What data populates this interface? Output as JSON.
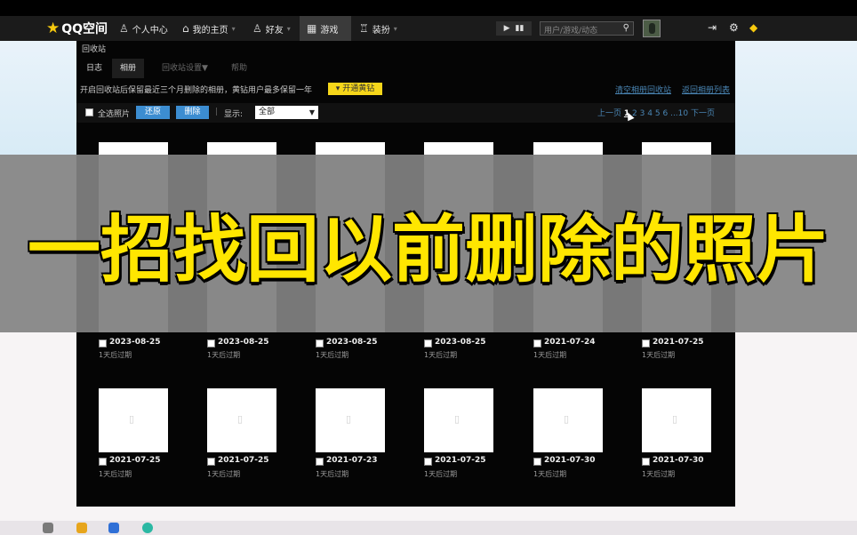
{
  "topbar": {
    "logo_text": "QQ空间",
    "nav": [
      {
        "label": "个人中心",
        "icon": "user-icon"
      },
      {
        "label": "我的主页",
        "icon": "home-icon"
      },
      {
        "label": "好友",
        "icon": "friends-icon"
      },
      {
        "label": "游戏",
        "icon": "grid-icon",
        "active": true
      },
      {
        "label": "装扮",
        "icon": "shirt-icon"
      }
    ],
    "search_placeholder": "用户/游戏/动态"
  },
  "panel": {
    "title": "回收站",
    "tabs": [
      "日志",
      "相册",
      "回收站设置▼",
      "帮助"
    ],
    "notice": "开启回收站后保留最近三个月删除的相册，黄钻用户最多保留一年",
    "vip_button": "开通黄钻",
    "links": [
      "清空相册回收站",
      "返回相册列表"
    ],
    "toolbar": {
      "select_all": "全选照片",
      "restore": "还原",
      "delete": "删除",
      "display_label": "显示:",
      "display_value": "全部"
    },
    "pager": {
      "prev": "上一页",
      "pages": [
        "1",
        "2",
        "3",
        "4",
        "5",
        "6",
        "...10"
      ],
      "current": "1",
      "next": "下一页"
    }
  },
  "photos": [
    {
      "date": "2023-08-25",
      "expire": "1天后过期"
    },
    {
      "date": "2023-08-25",
      "expire": "1天后过期"
    },
    {
      "date": "2023-08-25",
      "expire": "1天后过期"
    },
    {
      "date": "2023-08-25",
      "expire": "1天后过期"
    },
    {
      "date": "2021-07-24",
      "expire": "1天后过期"
    },
    {
      "date": "2021-07-25",
      "expire": "1天后过期"
    },
    {
      "date": "2021-07-25",
      "expire": "1天后过期"
    },
    {
      "date": "2021-07-25",
      "expire": "1天后过期"
    },
    {
      "date": "2021-07-23",
      "expire": "1天后过期"
    },
    {
      "date": "2021-07-25",
      "expire": "1天后过期"
    },
    {
      "date": "2021-07-30",
      "expire": "1天后过期"
    },
    {
      "date": "2021-07-30",
      "expire": "1天后过期"
    }
  ],
  "caption": "一招找回以前删除的照片",
  "colors": {
    "accent_yellow": "#f6d61a",
    "button_blue": "#3c8dd1",
    "link_blue": "#4a86b5",
    "caption_yellow": "#ffe600"
  }
}
